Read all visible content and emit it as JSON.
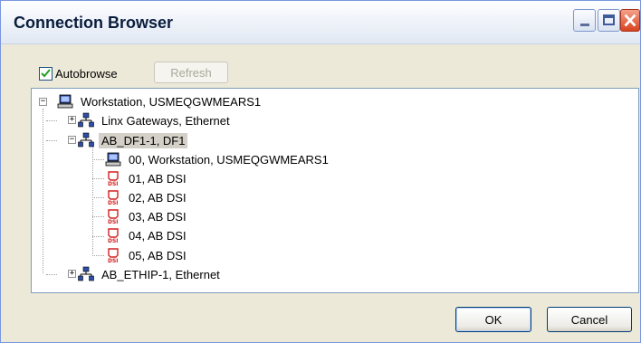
{
  "window": {
    "title": "Connection Browser"
  },
  "toolbar": {
    "autobrowse_label": "Autobrowse",
    "autobrowse_checked": true,
    "refresh_label": "Refresh"
  },
  "tree": {
    "root": {
      "label": "Workstation, USMEQGWMEARS1",
      "icon": "workstation-icon",
      "expanded": true
    },
    "children": [
      {
        "label": "Linx Gateways, Ethernet",
        "icon": "network-icon",
        "expanded": false
      },
      {
        "label": "AB_DF1-1, DF1",
        "icon": "network-icon",
        "expanded": true,
        "selected": true,
        "children": [
          {
            "label": "00, Workstation, USMEQGWMEARS1",
            "icon": "workstation-icon"
          },
          {
            "label": "01, AB DSI",
            "icon": "dsi-icon"
          },
          {
            "label": "02, AB DSI",
            "icon": "dsi-icon"
          },
          {
            "label": "03, AB DSI",
            "icon": "dsi-icon"
          },
          {
            "label": "04, AB DSI",
            "icon": "dsi-icon"
          },
          {
            "label": "05, AB DSI",
            "icon": "dsi-icon"
          }
        ]
      },
      {
        "label": "AB_ETHIP-1, Ethernet",
        "icon": "network-icon",
        "expanded": false
      }
    ]
  },
  "buttons": {
    "ok": "OK",
    "cancel": "Cancel"
  },
  "colors": {
    "dsi_icon": "#d22020",
    "selection": "#d4d0c8",
    "window_bg": "#ece9d8"
  }
}
